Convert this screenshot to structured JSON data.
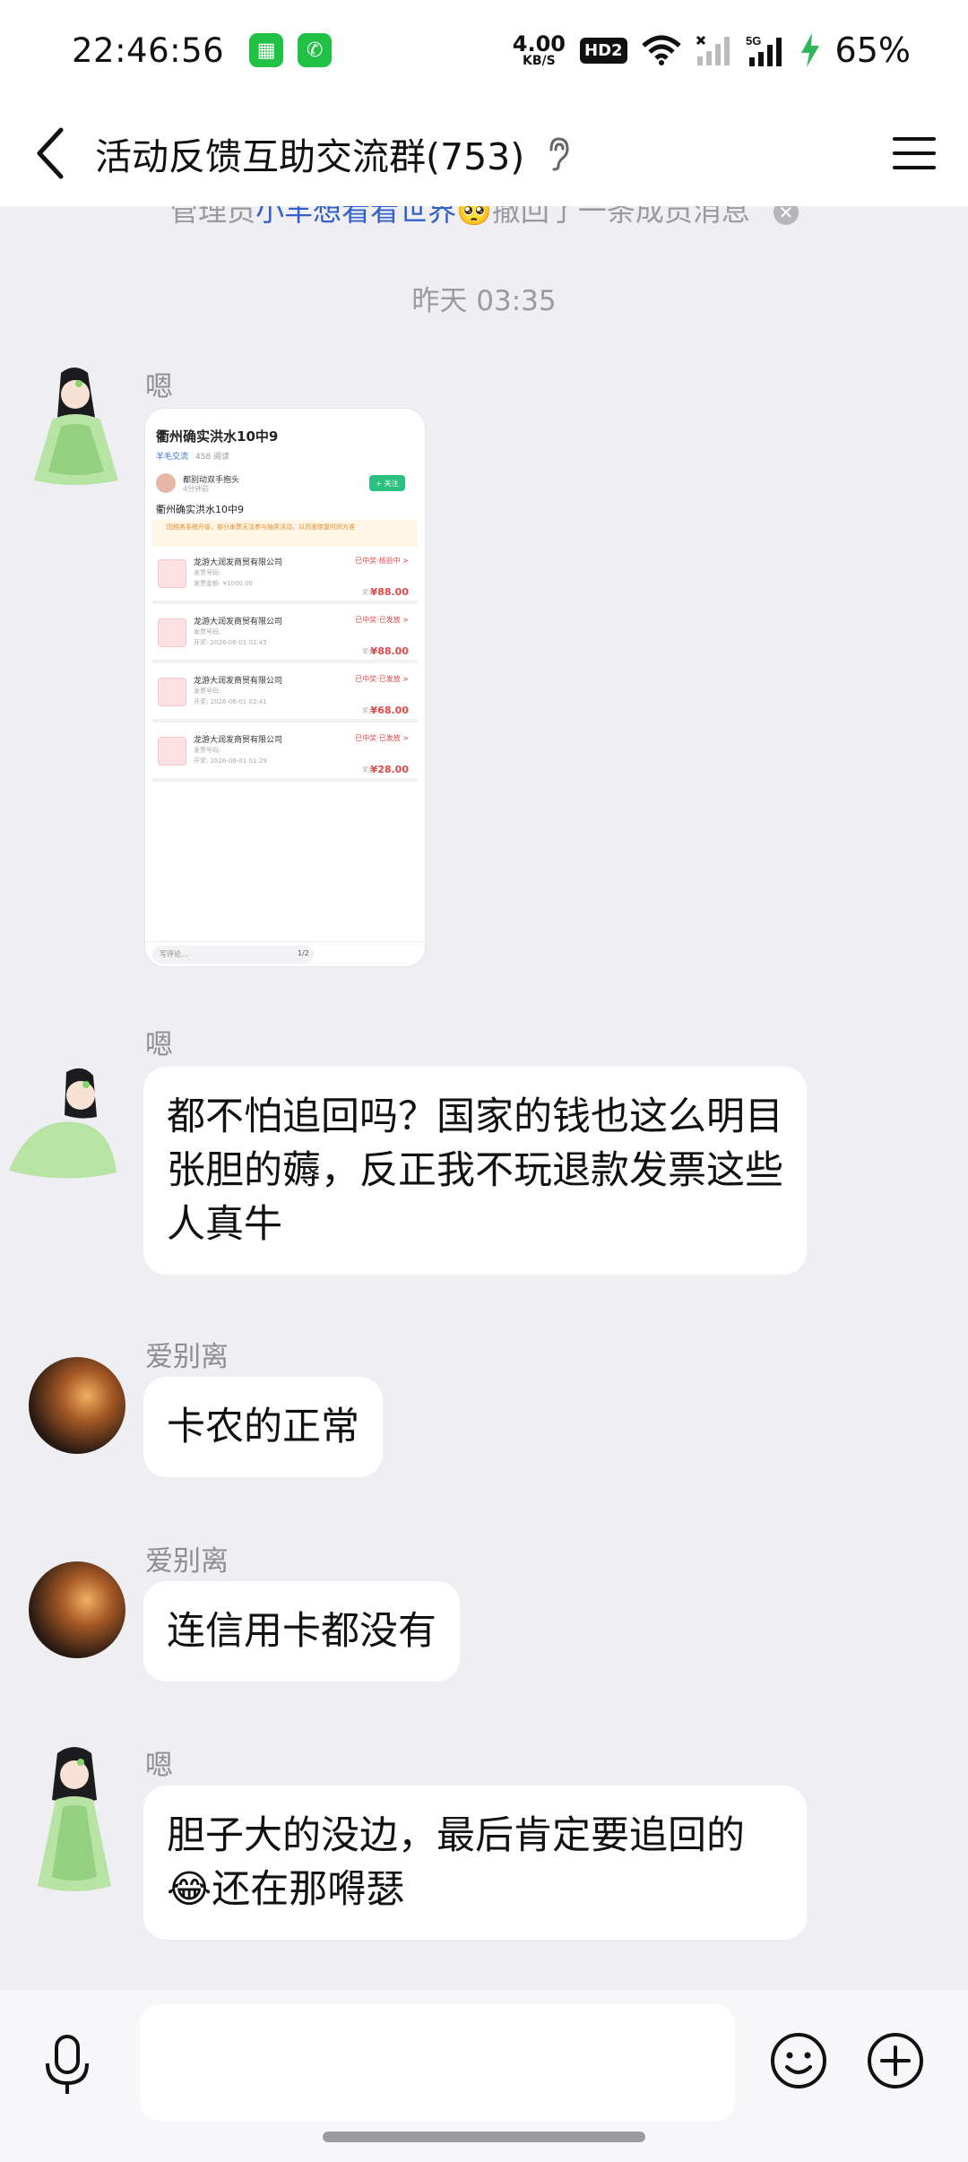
{
  "status_bar": {
    "time": "22:46:56",
    "net_speed_value": "4.00",
    "net_speed_unit": "KB/S",
    "hd_badge": "HD2",
    "signal_label": "5G",
    "battery": "65%"
  },
  "header": {
    "title": "活动反馈互助交流群(753)",
    "back_icon": "chevron-left-icon",
    "menu_icon": "hamburger-menu-icon"
  },
  "chat": {
    "recall_notice": {
      "prefix": "管理员",
      "admin_name": "小羊想看看世界🥺",
      "suffix": "撤回了一条成员消息"
    },
    "time_divider": "昨天 03:35",
    "messages": [
      {
        "sender": "嗯",
        "type": "image",
        "card": {
          "title": "衢州确实洪水10中9",
          "meta_tag": "羊毛交流",
          "meta_reads": "458 阅读",
          "author": "都别动双手抱头",
          "author_time": "4分钟前",
          "follow": "+ 关注",
          "body": "衢州确实洪水10中9",
          "notice": "因税务系统升级，部分发票无法参与抽奖活动，以页面恢复时间为准",
          "rows": [
            {
              "company": "龙游大润发商贸有限公司",
              "status": "已中奖·核验中 >",
              "line1": "发票号码:",
              "line2": "发票金额: ¥1000.00",
              "amount_label": "奖金",
              "amount": "¥88.00"
            },
            {
              "company": "龙游大润发商贸有限公司",
              "status": "已中奖·已发放 >",
              "line1": "发票号码:",
              "line2": "开奖: 2026-06-01 02:43",
              "amount_label": "奖金",
              "amount": "¥88.00"
            },
            {
              "company": "龙游大润发商贸有限公司",
              "status": "已中奖·已发放 >",
              "line1": "发票号码:",
              "line2": "开奖: 2026-06-01 02:41",
              "amount_label": "奖金",
              "amount": "¥68.00"
            },
            {
              "company": "龙游大润发商贸有限公司",
              "status": "已中奖·已发放 >",
              "line1": "发票号码:",
              "line2": "开奖: 2026-06-01 01:29",
              "amount_label": "奖金",
              "amount": "¥28.00"
            }
          ],
          "comment_placeholder": "写评论...",
          "page": "1/2"
        }
      },
      {
        "sender": "嗯",
        "type": "text",
        "text": "都不怕追回吗？国家的钱也这么明目张胆的薅，反正我不玩退款发票这些人真牛"
      },
      {
        "sender": "爱别离",
        "type": "text",
        "text": "卡农的正常"
      },
      {
        "sender": "爱别离",
        "type": "text",
        "text": "连信用卡都没有"
      },
      {
        "sender": "嗯",
        "type": "text",
        "text": "胆子大的没边，最后肯定要追回的😂还在那嘚瑟"
      }
    ]
  },
  "input_bar": {
    "mic_icon": "microphone-icon",
    "emoji_icon": "emoji-icon",
    "plus_icon": "plus-icon",
    "placeholder": ""
  }
}
